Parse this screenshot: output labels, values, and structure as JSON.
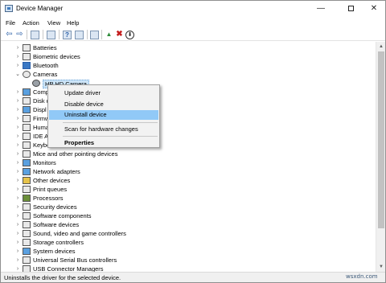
{
  "window": {
    "title": "Device Manager"
  },
  "window_controls": {
    "minimize": "—",
    "close": "✕"
  },
  "menu": {
    "items": [
      "File",
      "Action",
      "View",
      "Help"
    ]
  },
  "toolbar": {
    "icons": [
      "back-arrow-icon",
      "forward-arrow-icon",
      "show-hide-tree-icon",
      "properties-icon",
      "help-icon",
      "action-pane-icon",
      "monitor-icon",
      "update-driver-icon",
      "uninstall-x-icon",
      "download-icon"
    ],
    "glyphs": {
      "back": "⇦",
      "forward": "⇨",
      "help": "?",
      "uninstall": "✖",
      "download": "⬇",
      "update": "▲"
    }
  },
  "tree": {
    "collapsed_glyph": "›",
    "expanded_glyph": "⌄",
    "categories": [
      {
        "label": "Batteries",
        "icon": "battery-icon",
        "expanded": false
      },
      {
        "label": "Biometric devices",
        "icon": "fingerprint-icon",
        "expanded": false
      },
      {
        "label": "Bluetooth",
        "icon": "bluetooth-icon",
        "expanded": false
      },
      {
        "label": "Cameras",
        "icon": "camera-icon",
        "expanded": true
      },
      {
        "label": "HP HD Camera",
        "icon": "webcam-icon",
        "child": true,
        "selected": true
      },
      {
        "label": "Comp",
        "icon": "computer-icon",
        "expanded": false
      },
      {
        "label": "Disk d",
        "icon": "disk-drive-icon",
        "expanded": false
      },
      {
        "label": "Displ",
        "icon": "display-adapter-icon",
        "expanded": false
      },
      {
        "label": "Firmw",
        "icon": "firmware-icon",
        "expanded": false
      },
      {
        "label": "Huma",
        "icon": "human-interface-icon",
        "expanded": false
      },
      {
        "label": "IDE A",
        "icon": "ide-controller-icon",
        "expanded": false
      },
      {
        "label": "Keybo",
        "icon": "keyboard-icon",
        "expanded": false
      },
      {
        "label": "Mice and other pointing devices",
        "icon": "mouse-icon",
        "expanded": false
      },
      {
        "label": "Monitors",
        "icon": "monitor-icon",
        "expanded": false
      },
      {
        "label": "Network adapters",
        "icon": "network-adapter-icon",
        "expanded": false
      },
      {
        "label": "Other devices",
        "icon": "other-device-icon",
        "expanded": false
      },
      {
        "label": "Print queues",
        "icon": "printer-icon",
        "expanded": false
      },
      {
        "label": "Processors",
        "icon": "processor-icon",
        "expanded": false
      },
      {
        "label": "Security devices",
        "icon": "security-device-icon",
        "expanded": false
      },
      {
        "label": "Software components",
        "icon": "software-component-icon",
        "expanded": false
      },
      {
        "label": "Software devices",
        "icon": "software-device-icon",
        "expanded": false
      },
      {
        "label": "Sound, video and game controllers",
        "icon": "speaker-icon",
        "expanded": false
      },
      {
        "label": "Storage controllers",
        "icon": "storage-controller-icon",
        "expanded": false
      },
      {
        "label": "System devices",
        "icon": "system-device-icon",
        "expanded": false
      },
      {
        "label": "Universal Serial Bus controllers",
        "icon": "usb-icon",
        "expanded": false
      },
      {
        "label": "USB Connector Managers",
        "icon": "usb-connector-icon",
        "expanded": false
      }
    ]
  },
  "context_menu": {
    "items": [
      {
        "label": "Update driver"
      },
      {
        "label": "Disable device"
      },
      {
        "label": "Uninstall device",
        "highlighted": true
      },
      {
        "label": "Scan for hardware changes"
      },
      {
        "label": "Properties",
        "bold": true
      }
    ]
  },
  "scrollbar": {
    "up_glyph": "▲",
    "down_glyph": "▼",
    "thumb_fraction": 0.84
  },
  "status": {
    "text": "Uninstalls the driver for the selected device."
  },
  "watermark": "wsxdn.com",
  "colors": {
    "selection": "#cce4f7",
    "menu_highlight": "#91c9f7",
    "toolbar_blue": "#2b5fa8",
    "uninstall_red": "#c41e1e"
  }
}
